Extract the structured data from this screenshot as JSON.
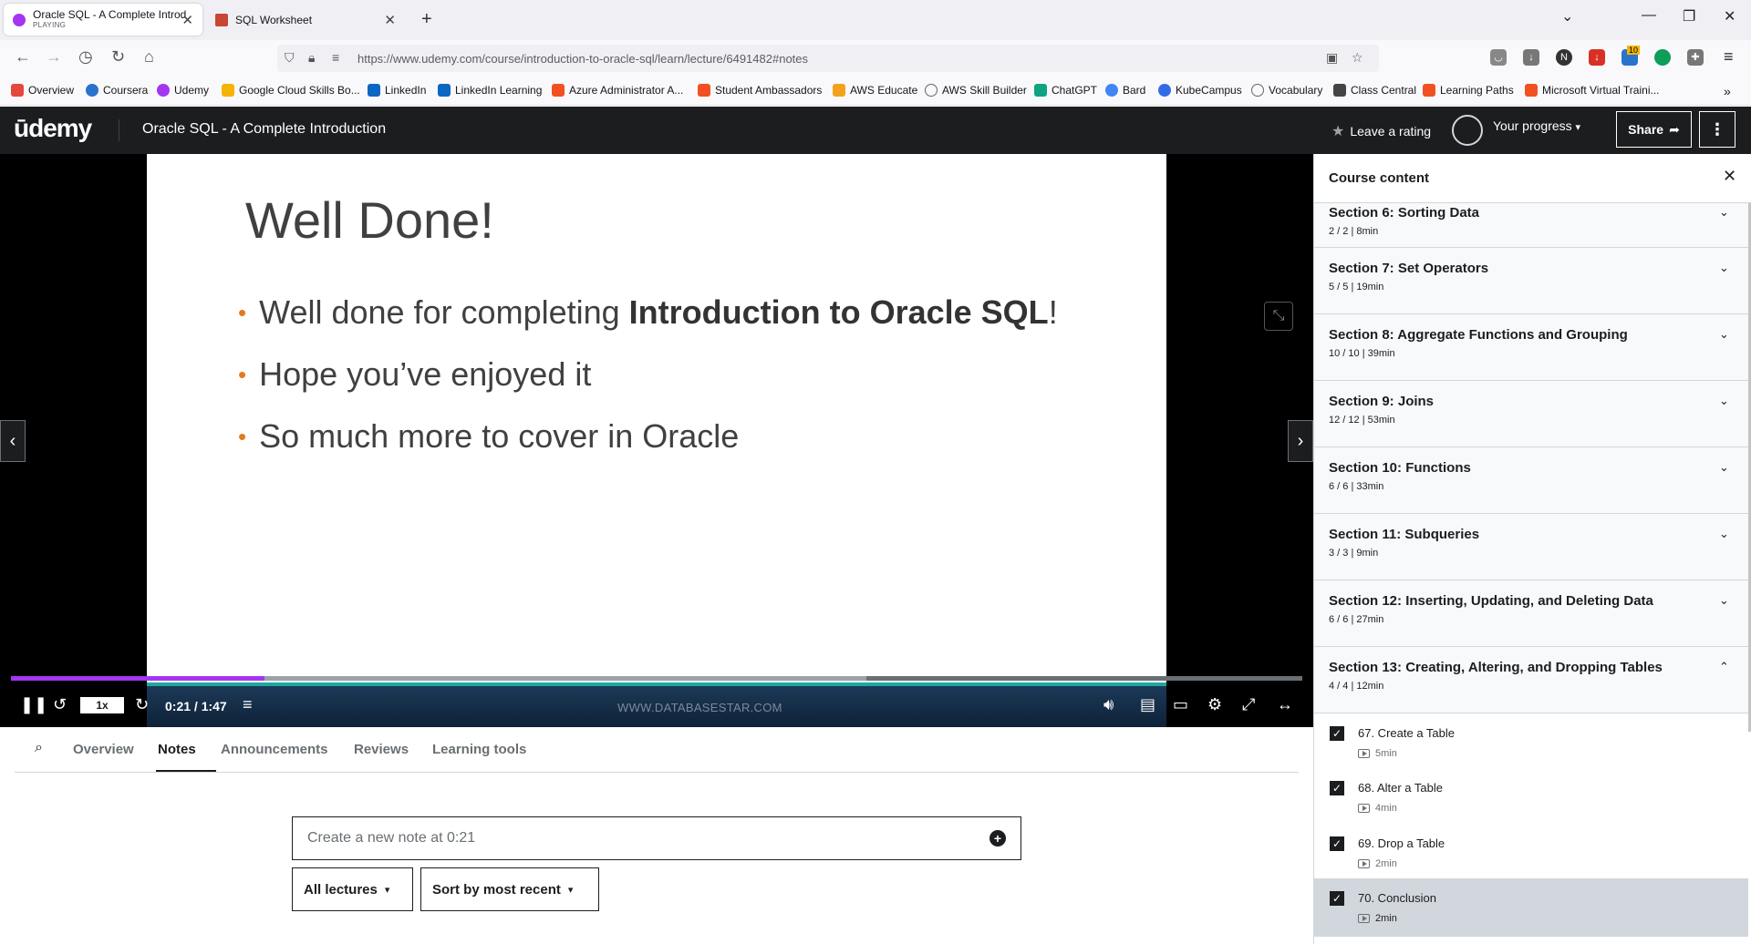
{
  "browser": {
    "tabs": [
      {
        "title": "Oracle SQL - A Complete Introd",
        "subtitle": "PLAYING"
      },
      {
        "title": "SQL Worksheet",
        "subtitle": ""
      }
    ],
    "url": "https://www.udemy.com/course/introduction-to-oracle-sql/learn/lecture/6491482#notes",
    "bookmarks": [
      {
        "label": "Overview",
        "color": "#e5483c"
      },
      {
        "label": "Coursera",
        "color": "#2a73cc"
      },
      {
        "label": "Udemy",
        "color": "#a435f0"
      },
      {
        "label": "Google Cloud Skills Bo...",
        "color": "#f4b400"
      },
      {
        "label": "LinkedIn",
        "color": "#0a66c2"
      },
      {
        "label": "LinkedIn Learning",
        "color": "#0a66c2"
      },
      {
        "label": "Azure Administrator A...",
        "color": "#f25022"
      },
      {
        "label": "Student Ambassadors",
        "color": "#f25022"
      },
      {
        "label": "AWS Educate",
        "color": "#f2a31b"
      },
      {
        "label": "AWS Skill Builder",
        "color": "#666666"
      },
      {
        "label": "ChatGPT",
        "color": "#10a37f"
      },
      {
        "label": "Bard",
        "color": "#4285f4"
      },
      {
        "label": "KubeCampus",
        "color": "#326ce5"
      },
      {
        "label": "Vocabulary",
        "color": "#666666"
      },
      {
        "label": "Class Central",
        "color": "#444444"
      },
      {
        "label": "Learning Paths",
        "color": "#f25022"
      },
      {
        "label": "Microsoft Virtual Traini...",
        "color": "#f25022"
      }
    ],
    "badge_count": "10"
  },
  "header": {
    "logo": "ūdemy",
    "course_title": "Oracle SQL - A Complete Introduction",
    "leave_rating": "Leave a rating",
    "your_progress": "Your progress",
    "share": "Share"
  },
  "video": {
    "slide_title": "Well Done!",
    "bullet1_pre": "Well done for completing ",
    "bullet1_bold": "Introduction to Oracle SQL",
    "bullet1_post": "!",
    "bullet2": "Hope you’ve enjoyed it",
    "bullet3": "So much more to cover in Oracle",
    "speed": "1x",
    "time": "0:21 / 1:47",
    "watermark": "WWW.DATABASESTAR.COM",
    "progress_fraction": 0.196,
    "accent": "#a435f0"
  },
  "tabs": [
    "Overview",
    "Notes",
    "Announcements",
    "Reviews",
    "Learning tools"
  ],
  "active_tab": "Notes",
  "notes": {
    "placeholder": "Create a new note at 0:21",
    "filter": "All lectures",
    "sort": "Sort by most recent"
  },
  "sidebar": {
    "title": "Course content",
    "sections": [
      {
        "title": "Section 6: Sorting Data",
        "meta": "2 / 2 | 8min"
      },
      {
        "title": "Section 7: Set Operators",
        "meta": "5 / 5 | 19min"
      },
      {
        "title": "Section 8: Aggregate Functions and Grouping",
        "meta": "10 / 10 | 39min"
      },
      {
        "title": "Section 9: Joins",
        "meta": "12 / 12 | 53min"
      },
      {
        "title": "Section 10: Functions",
        "meta": "6 / 6 | 33min"
      },
      {
        "title": "Section 11: Subqueries",
        "meta": "3 / 3 | 9min"
      },
      {
        "title": "Section 12: Inserting, Updating, and Deleting Data",
        "meta": "6 / 6 | 27min"
      },
      {
        "title": "Section 13: Creating, Altering, and Dropping Tables",
        "meta": "4 / 4 | 12min"
      }
    ],
    "lectures": [
      {
        "title": "67. Create a Table",
        "duration": "5min"
      },
      {
        "title": "68. Alter a Table",
        "duration": "4min"
      },
      {
        "title": "69. Drop a Table",
        "duration": "2min"
      },
      {
        "title": "70. Conclusion",
        "duration": "2min"
      }
    ]
  }
}
